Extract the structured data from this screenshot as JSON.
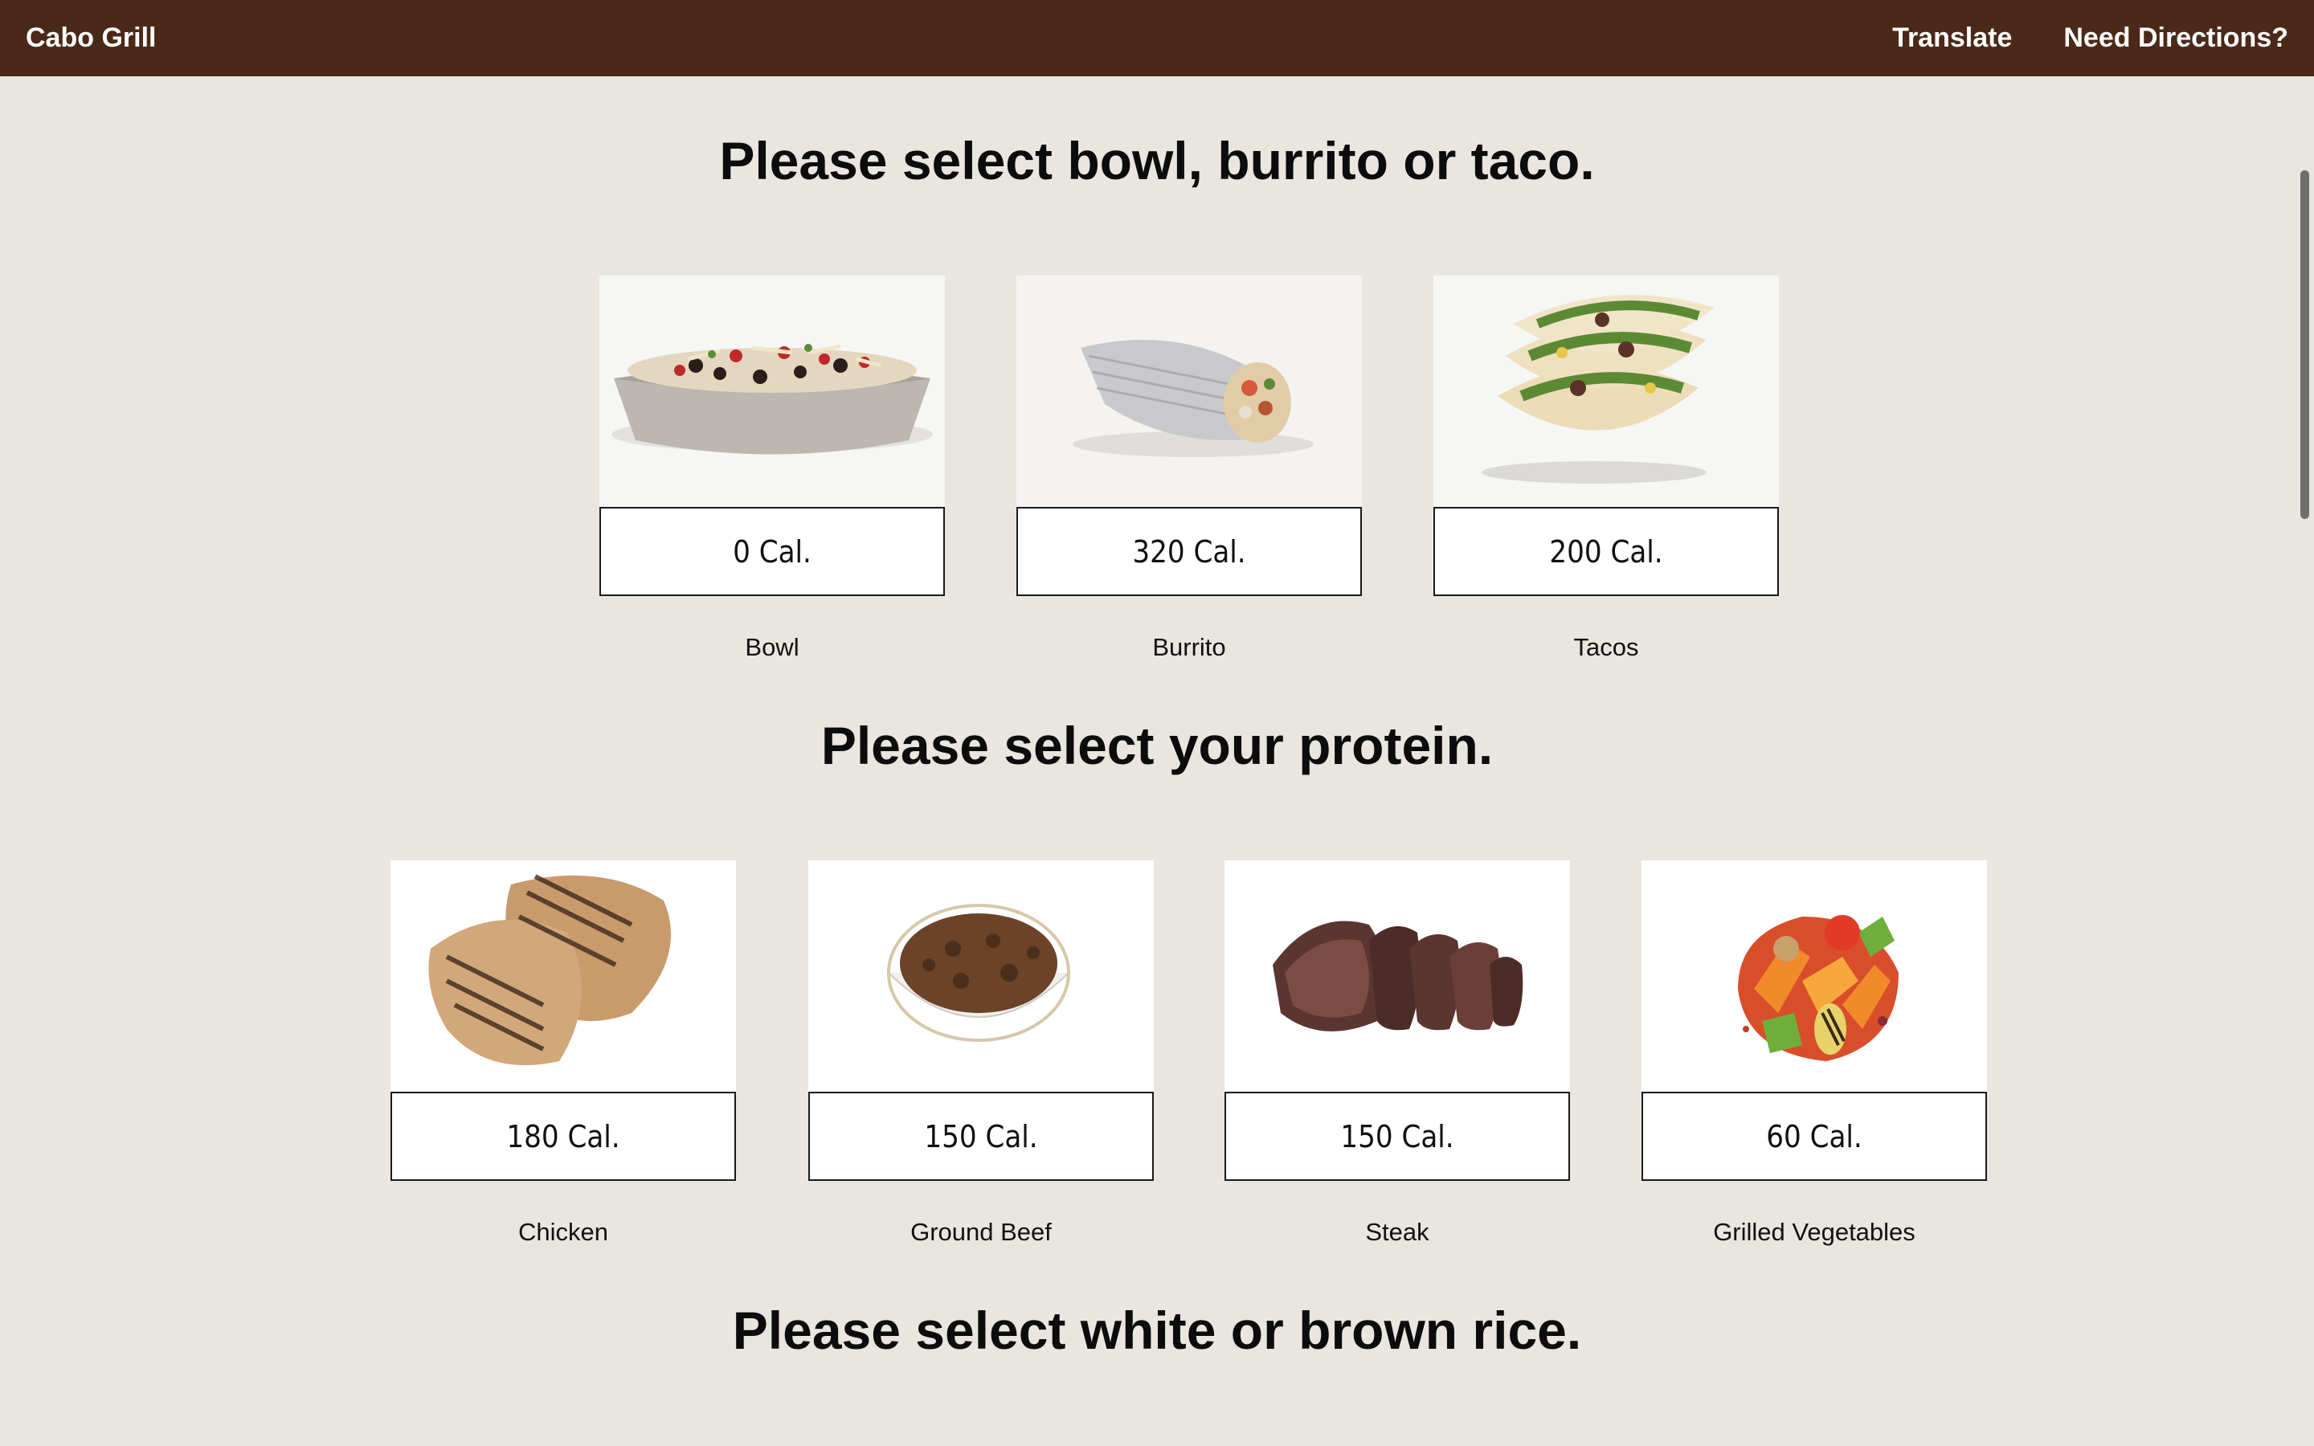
{
  "header": {
    "brand": "Cabo Grill",
    "nav": [
      "Translate",
      "Need Directions?"
    ],
    "bg_color": "#4a2918"
  },
  "sections": [
    {
      "title": "Please select bowl, burrito or taco.",
      "items": [
        {
          "name": "Bowl",
          "calories": "0 Cal.",
          "image": "bowl-photo"
        },
        {
          "name": "Burrito",
          "calories": "320 Cal.",
          "image": "burrito-photo"
        },
        {
          "name": "Tacos",
          "calories": "200 Cal.",
          "image": "tacos-photo"
        }
      ]
    },
    {
      "title": "Please select your protein.",
      "items": [
        {
          "name": "Chicken",
          "calories": "180 Cal.",
          "image": "chicken-photo"
        },
        {
          "name": "Ground Beef",
          "calories": "150 Cal.",
          "image": "ground-beef-photo"
        },
        {
          "name": "Steak",
          "calories": "150 Cal.",
          "image": "steak-photo"
        },
        {
          "name": "Grilled Vegetables",
          "calories": "60 Cal.",
          "image": "grilled-vegetables-photo"
        }
      ]
    },
    {
      "title": "Please select white or brown rice.",
      "items": []
    }
  ],
  "page_bg": "#e8e6df"
}
